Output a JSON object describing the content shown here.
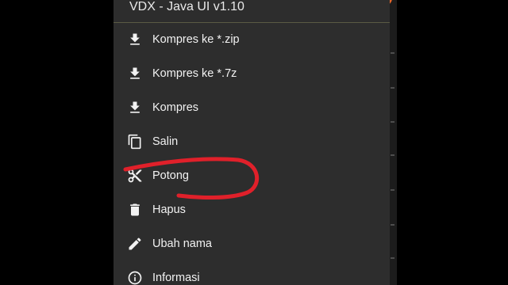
{
  "menu": {
    "title": "VDX - Java UI v1.10",
    "items": [
      {
        "label": "Kompres ke *.zip",
        "icon": "download-icon"
      },
      {
        "label": "Kompres ke *.7z",
        "icon": "download-icon"
      },
      {
        "label": "Kompres",
        "icon": "download-icon"
      },
      {
        "label": "Salin",
        "icon": "copy-icon"
      },
      {
        "label": "Potong",
        "icon": "scissors-icon"
      },
      {
        "label": "Hapus",
        "icon": "trash-icon"
      },
      {
        "label": "Ubah nama",
        "icon": "pencil-icon"
      },
      {
        "label": "Informasi",
        "icon": "info-icon"
      }
    ]
  },
  "colors": {
    "menu_bg": "#2d2d2d",
    "text": "#f2f2f2",
    "accent": "#e8662a",
    "annotation": "#e0202a"
  }
}
